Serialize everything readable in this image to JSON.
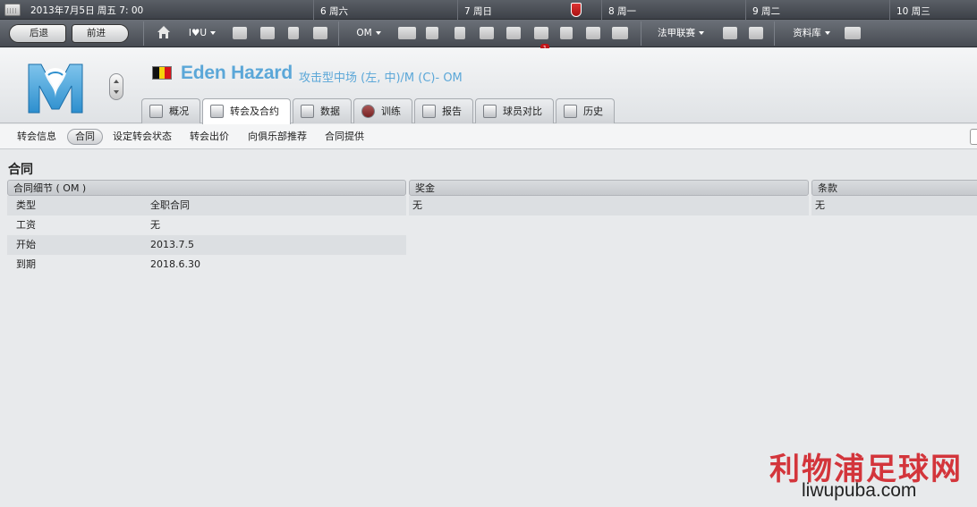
{
  "datebar": {
    "current": "2013年7月5日 周五  7: 00",
    "days": [
      "6 周六",
      "7 周日",
      "8 周一",
      "9 周二",
      "10 周三"
    ]
  },
  "toolbar": {
    "back": "后退",
    "forward": "前进",
    "user_menu": "I♥U",
    "club_menu": "OM",
    "inbox_count": "1",
    "league_menu": "法甲联赛",
    "database_menu": "资料库"
  },
  "player": {
    "name": "Eden Hazard",
    "position": "攻击型中场 (左, 中)/M (C)- OM",
    "flag_colors": [
      "#111111",
      "#f5d20b",
      "#d7141a"
    ]
  },
  "tabs": [
    {
      "label": "概况",
      "icon": "overview-icon"
    },
    {
      "label": "转会及合约",
      "icon": "contract-icon",
      "active": true
    },
    {
      "label": "数据",
      "icon": "stats-icon"
    },
    {
      "label": "训练",
      "icon": "training-icon"
    },
    {
      "label": "报告",
      "icon": "report-icon"
    },
    {
      "label": "球员对比",
      "icon": "compare-icon"
    },
    {
      "label": "历史",
      "icon": "history-icon"
    }
  ],
  "subnav": [
    "转会信息",
    "合同",
    "设定转会状态",
    "转会出价",
    "向俱乐部推荐",
    "合同提供"
  ],
  "section_title": "合同",
  "contract": {
    "header": "合同细节 ( OM )",
    "rows": [
      {
        "key": "类型",
        "value": "全职合同"
      },
      {
        "key": "工资",
        "value": "无"
      },
      {
        "key": "开始",
        "value": "2013.7.5"
      },
      {
        "key": "到期",
        "value": "2018.6.30"
      }
    ]
  },
  "bonus": {
    "header": "奖金",
    "value": "无"
  },
  "clauses": {
    "header": "条款",
    "value": "无"
  },
  "watermark": {
    "title": "利物浦足球网",
    "url": "liwupuba.com"
  },
  "colors": {
    "accent": "#5ba7d8",
    "badge": "#c0151a"
  }
}
